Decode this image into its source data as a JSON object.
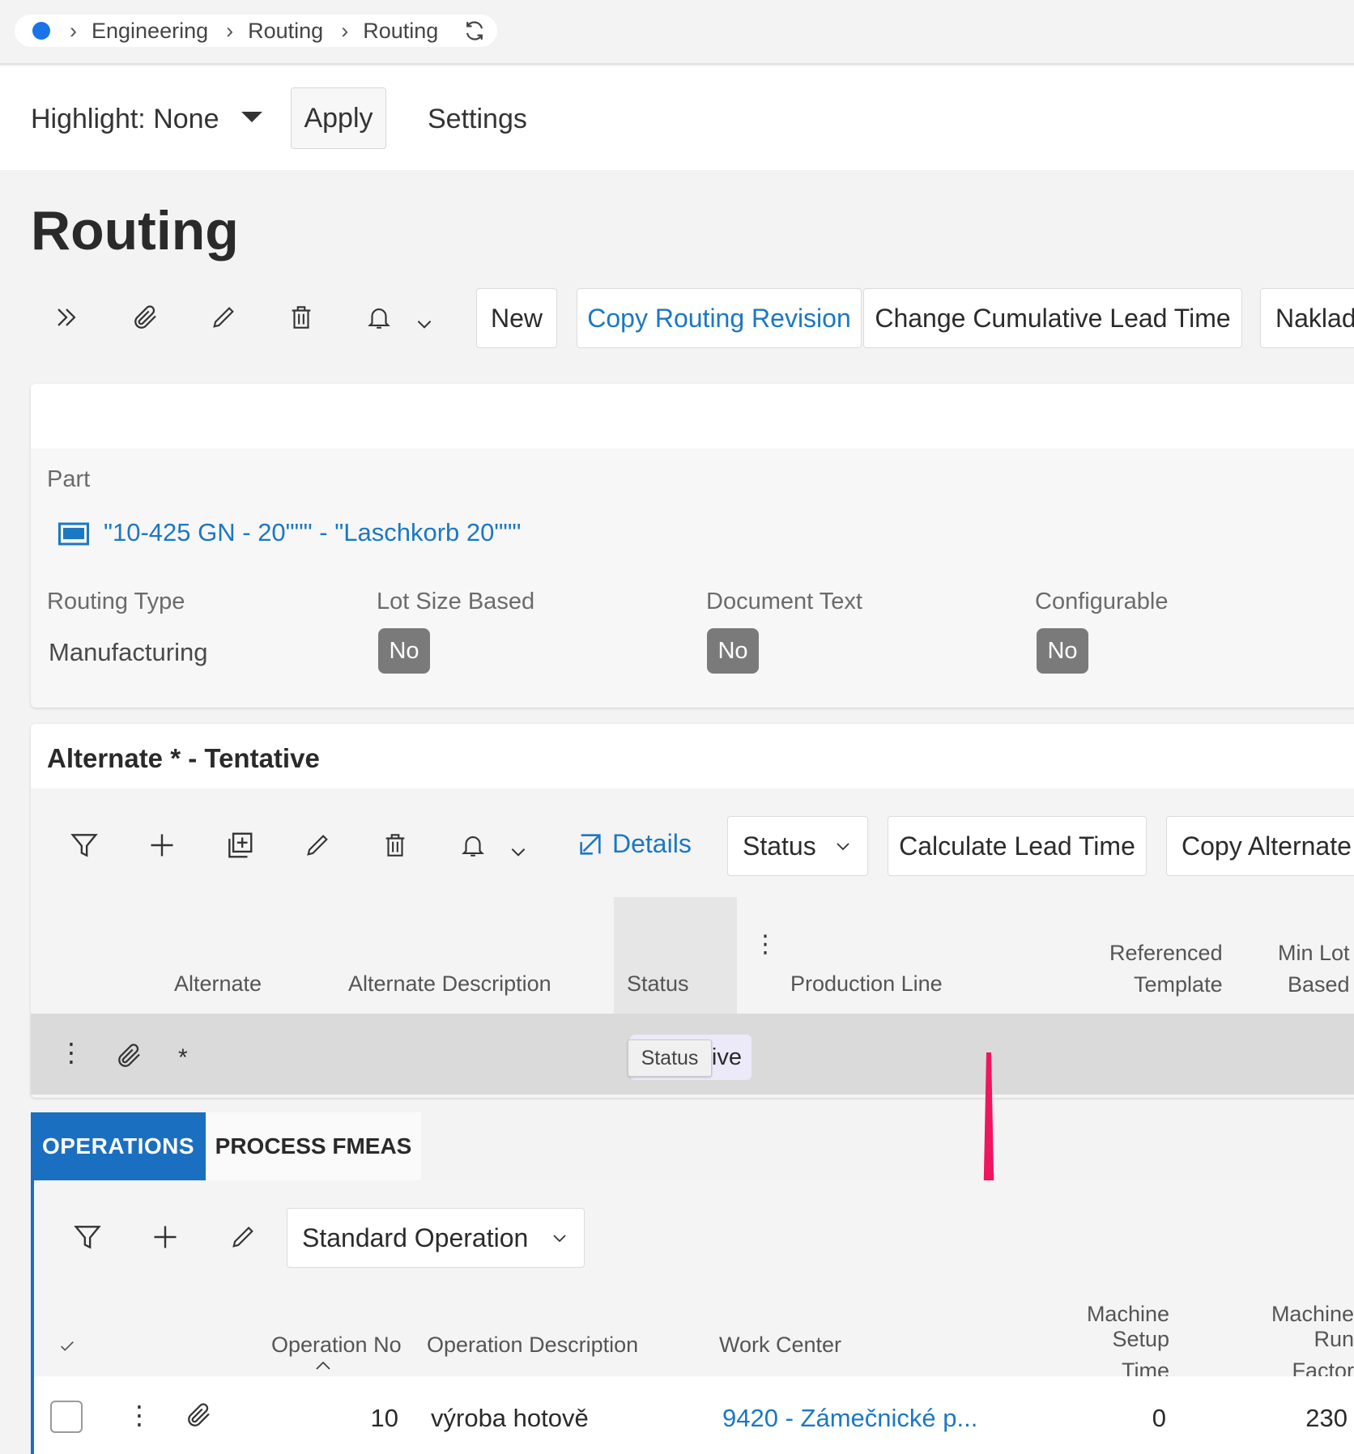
{
  "breadcrumb": {
    "items": [
      "Engineering",
      "Routing",
      "Routing"
    ]
  },
  "highlight": {
    "label": "Highlight: None",
    "apply_label": "Apply",
    "settings_label": "Settings"
  },
  "page": {
    "title": "Routing"
  },
  "main_toolbar": {
    "buttons": [
      "New",
      "Copy Routing Revision",
      "Change Cumulative Lead Time",
      "Naklad"
    ]
  },
  "header": {
    "part_label": "Part",
    "part_value": "\"10-425 GN - 20\"\"\" - \"Laschkorb 20\"\"\"",
    "routing_type_label": "Routing Type",
    "routing_type_value": "Manufacturing",
    "lot_size_based_label": "Lot Size Based",
    "lot_size_based_value": "No",
    "document_text_label": "Document Text",
    "document_text_value": "No",
    "configurable_label": "Configurable",
    "configurable_value": "No"
  },
  "alternate": {
    "title": "Alternate * - Tentative",
    "toolbar": {
      "details_label": "Details",
      "status_label": "Status",
      "calc_lead_time_label": "Calculate Lead Time",
      "copy_alternate_label": "Copy Alternate"
    },
    "columns": {
      "alternate": "Alternate",
      "alternate_description": "Alternate Description",
      "status": "Status",
      "production_line": "Production Line",
      "referenced_template_1": "Referenced",
      "referenced_template_2": "Template",
      "min_lot_1": "Min Lot",
      "min_lot_2": "Based"
    },
    "row": {
      "alternate": "*",
      "status_fragment": "ive"
    },
    "tooltip": "Status"
  },
  "tabs": {
    "operations": "OPERATIONS",
    "process_fmeas": "PROCESS FMEAS"
  },
  "operations": {
    "toolbar": {
      "standard_operation_label": "Standard Operation"
    },
    "columns": {
      "operation_no": "Operation No",
      "operation_description": "Operation Description",
      "work_center": "Work Center",
      "machine_setup_time_1": "Machine Setup",
      "machine_setup_time_2": "Time",
      "machine_run_factor_1": "Machine Run",
      "machine_run_factor_2": "Factor"
    },
    "rows": [
      {
        "operation_no": "10",
        "operation_description": "výroba hotově",
        "work_center": "9420 - Zámečnické p...",
        "machine_setup_time": "0",
        "machine_run_factor": "230"
      }
    ]
  },
  "colors": {
    "accent": "#1b6fc0",
    "link": "#1b78c2",
    "arrow": "#f0155f",
    "badge": "#7a7a7a"
  }
}
